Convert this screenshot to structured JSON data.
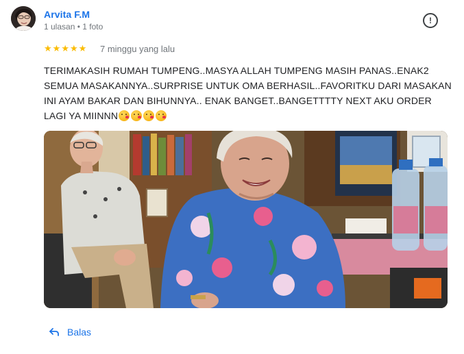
{
  "reviewer": {
    "name": "Arvita F.M",
    "meta": "1 ulasan • 1 foto"
  },
  "review": {
    "rating": 5,
    "time": "7 minggu yang lalu",
    "text": "TERIMAKASIH RUMAH TUMPENG..MASYA ALLAH TUMPENG MASIH PANAS..ENAK2 SEMUA MASAKANNYA..SURPRISE UNTUK OMA BERHASIL..FAVORITKU DARI MASAKAN INI AYAM BAKAR DAN BIHUNNYA.. ENAK BANGET..BANGETTTTY NEXT AKU ORDER LAGI YA MIINNN",
    "emoji_count": 4,
    "emoji_icon": "face-blowing-kiss-icon"
  },
  "actions": {
    "reply_label": "Balas",
    "report_icon": "report-icon"
  },
  "colors": {
    "accent": "#1a73e8",
    "star": "#fbbc04",
    "secondary_text": "#70757a"
  }
}
